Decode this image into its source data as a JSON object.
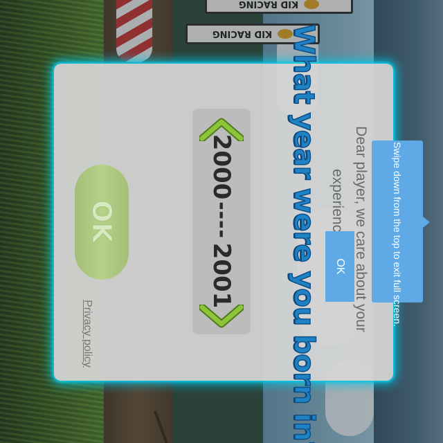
{
  "background": {
    "banner_text": "KID RACING"
  },
  "dialog": {
    "question": "What year were you born in?",
    "subtitle": "Dear player, we care about your experience with us",
    "year_picker": {
      "start_year": "2000",
      "separator": "----",
      "end_year": "2001",
      "prev_icon": "chevron-left-icon",
      "next_icon": "chevron-right-icon"
    },
    "ok_label": "OK",
    "privacy_label": "Privacy policy"
  },
  "system_tooltip": {
    "text": "Swipe down from the top to exit full screen.",
    "ok_label": "OK"
  },
  "colors": {
    "accent_blue": "#1f82c5",
    "glow": "#16c3e2",
    "ok_green": "#b2d27c",
    "tooltip_blue": "#5ea9e6"
  }
}
